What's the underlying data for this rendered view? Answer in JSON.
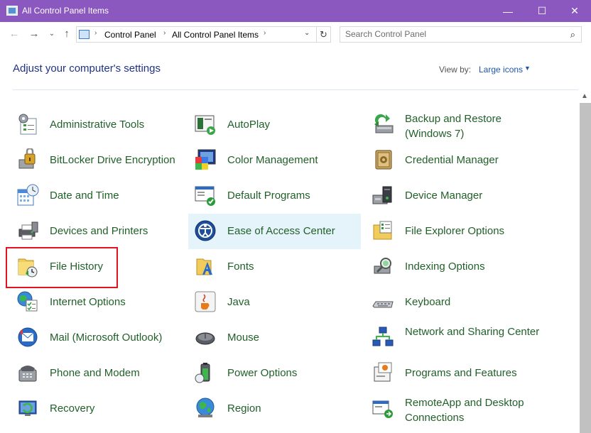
{
  "window": {
    "title": "All Control Panel Items",
    "minimize_label": "—",
    "maximize_label": "☐",
    "close_label": "✕"
  },
  "address_bar": {
    "breadcrumbs": [
      "Control Panel",
      "All Control Panel Items"
    ],
    "search_placeholder": "Search Control Panel"
  },
  "header": {
    "title": "Adjust your computer's settings",
    "view_by_label": "View by:",
    "view_by_value": "Large icons"
  },
  "items": [
    {
      "label": "Administrative Tools",
      "icon": "administrative-tools-icon"
    },
    {
      "label": "AutoPlay",
      "icon": "autoplay-icon"
    },
    {
      "label": "Backup and Restore (Windows 7)",
      "icon": "backup-restore-icon"
    },
    {
      "label": "BitLocker Drive Encryption",
      "icon": "bitlocker-icon"
    },
    {
      "label": "Color Management",
      "icon": "color-management-icon"
    },
    {
      "label": "Credential Manager",
      "icon": "credential-manager-icon"
    },
    {
      "label": "Date and Time",
      "icon": "date-time-icon"
    },
    {
      "label": "Default Programs",
      "icon": "default-programs-icon"
    },
    {
      "label": "Device Manager",
      "icon": "device-manager-icon"
    },
    {
      "label": "Devices and Printers",
      "icon": "devices-printers-icon"
    },
    {
      "label": "Ease of Access Center",
      "icon": "ease-of-access-icon"
    },
    {
      "label": "File Explorer Options",
      "icon": "file-explorer-options-icon"
    },
    {
      "label": "File History",
      "icon": "file-history-icon"
    },
    {
      "label": "Fonts",
      "icon": "fonts-icon"
    },
    {
      "label": "Indexing Options",
      "icon": "indexing-options-icon"
    },
    {
      "label": "Internet Options",
      "icon": "internet-options-icon"
    },
    {
      "label": "Java",
      "icon": "java-icon"
    },
    {
      "label": "Keyboard",
      "icon": "keyboard-icon"
    },
    {
      "label": "Mail (Microsoft Outlook)",
      "icon": "mail-icon"
    },
    {
      "label": "Mouse",
      "icon": "mouse-icon"
    },
    {
      "label": "Network and Sharing Center",
      "icon": "network-sharing-icon"
    },
    {
      "label": "Phone and Modem",
      "icon": "phone-modem-icon"
    },
    {
      "label": "Power Options",
      "icon": "power-options-icon"
    },
    {
      "label": "Programs and Features",
      "icon": "programs-features-icon"
    },
    {
      "label": "Recovery",
      "icon": "recovery-icon"
    },
    {
      "label": "Region",
      "icon": "region-icon"
    },
    {
      "label": "RemoteApp and Desktop Connections",
      "icon": "remoteapp-icon"
    }
  ],
  "highlighted_item": "Ease of Access Center",
  "annotated_item": "File History",
  "colors": {
    "title_bar": "#8a58be",
    "item_text": "#22602a",
    "heading_text": "#1e3287",
    "link": "#1e56a8",
    "hover_bg": "#e5f3fb",
    "annotation_box": "#e0141e"
  }
}
